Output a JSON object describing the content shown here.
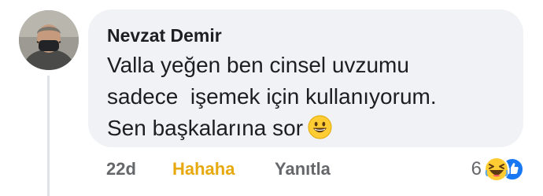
{
  "comment": {
    "author": "Nevzat Demir",
    "body_lines": [
      "Valla yeğen ben cinsel uvzumu",
      "sadece  işemek için kullanıyorum.",
      "Sen başkalarına sor"
    ],
    "inline_emoji": "grinning-face-icon",
    "avatar_icon": "user-avatar-photo"
  },
  "actions": {
    "timestamp": "22d",
    "reaction_label": "Hahaha",
    "reply_label": "Yanıtla"
  },
  "reactions": {
    "count": "6",
    "types": [
      "haha-icon",
      "like-icon"
    ]
  },
  "colors": {
    "bubble": "#f0f2f5",
    "text": "#1c1e21",
    "meta": "#65676b",
    "haha_active": "#e7a90e",
    "like_blue": "#1877f2"
  }
}
